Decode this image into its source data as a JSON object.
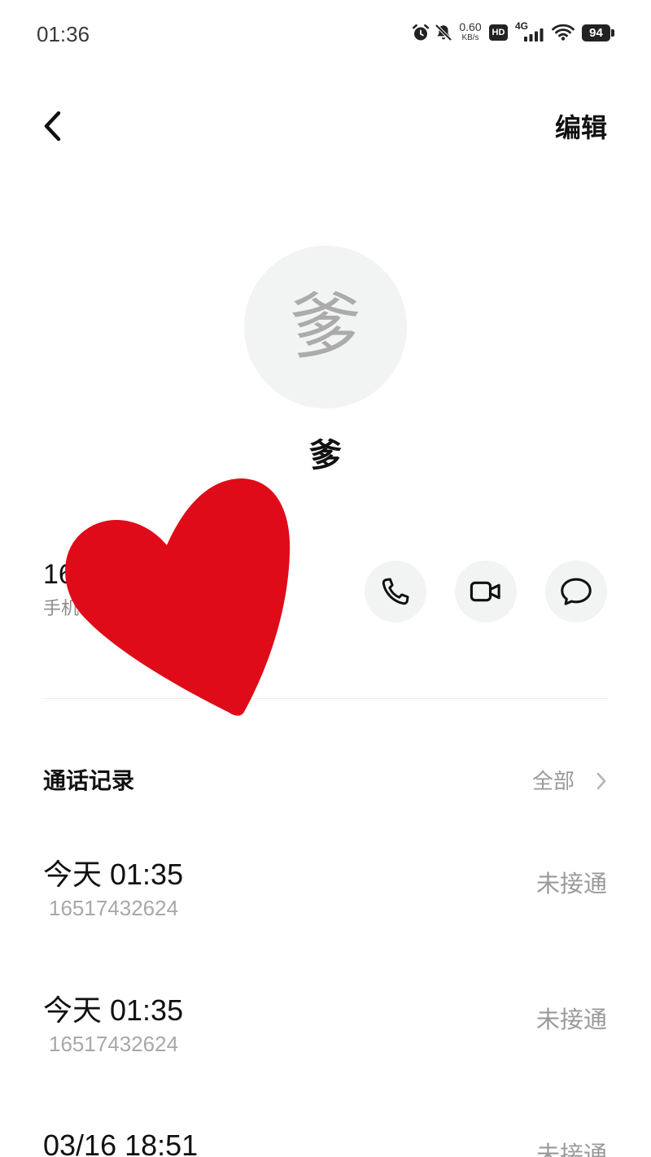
{
  "status_bar": {
    "time": "01:36",
    "net_speed": "0.60",
    "net_speed_unit": "KB/s",
    "hd_badge": "HD",
    "network_type": "4G",
    "battery_level": "94",
    "icons": [
      "alarm-icon",
      "bell-off-icon",
      "signal-bars-icon",
      "wifi-icon",
      "battery-icon"
    ]
  },
  "header": {
    "back_icon": "chevron-left-icon",
    "edit_label": "编辑"
  },
  "contact": {
    "avatar_text": "爹",
    "name": "爹",
    "phone_number": "16",
    "phone_label": "手机",
    "action_icons": [
      "phone-icon",
      "video-camera-icon",
      "message-icon"
    ]
  },
  "call_log": {
    "title": "通话记录",
    "view_all_label": "全部",
    "view_all_icon": "chevron-right-icon",
    "entries": [
      {
        "time": "今天 01:35",
        "number": "16517432624",
        "status": "未接通"
      },
      {
        "time": "今天 01:35",
        "number": "16517432624",
        "status": "未接通"
      },
      {
        "time": "03/16 18:51",
        "status": "未接通"
      }
    ]
  },
  "colors": {
    "heart_sticker": "#e00b19",
    "circle_background": "#f2f3f3",
    "secondary_text": "#9a9a9a",
    "primary_text": "#111111"
  }
}
